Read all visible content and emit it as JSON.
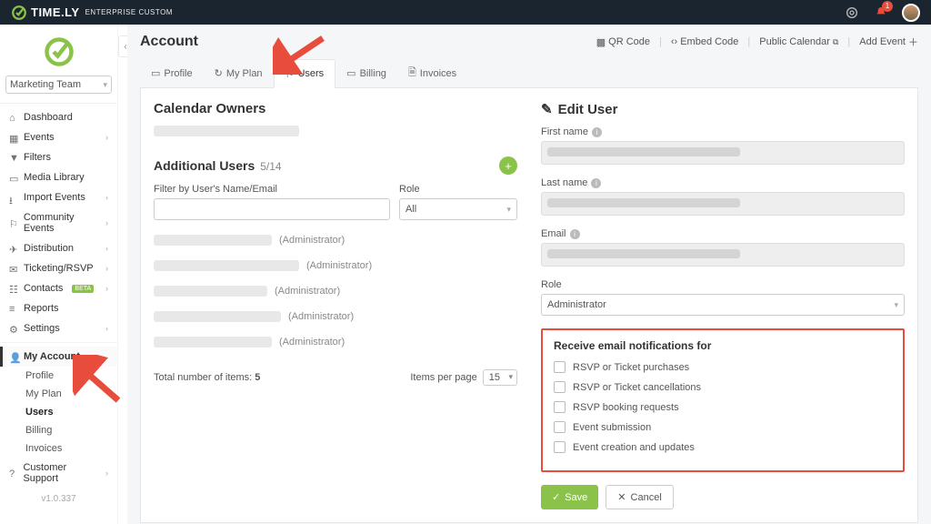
{
  "brand": {
    "name": "TIME.LY",
    "suffix": "ENTERPRISE CUSTOM"
  },
  "topbar": {
    "notif_count": "1"
  },
  "team_selector": {
    "value": "Marketing Team"
  },
  "sidebar": {
    "items": [
      {
        "label": "Dashboard",
        "icon": "dashboard"
      },
      {
        "label": "Events",
        "icon": "calendar",
        "expandable": true
      },
      {
        "label": "Filters",
        "icon": "filter"
      },
      {
        "label": "Media Library",
        "icon": "media"
      },
      {
        "label": "Import Events",
        "icon": "import",
        "expandable": true
      },
      {
        "label": "Community Events",
        "icon": "community",
        "expandable": true
      },
      {
        "label": "Distribution",
        "icon": "distribution",
        "expandable": true
      },
      {
        "label": "Ticketing/RSVP",
        "icon": "ticket",
        "expandable": true
      },
      {
        "label": "Contacts",
        "icon": "contacts",
        "expandable": true,
        "badge": "BETA"
      },
      {
        "label": "Reports",
        "icon": "reports"
      },
      {
        "label": "Settings",
        "icon": "settings",
        "expandable": true
      }
    ],
    "account": {
      "label": "My Account"
    },
    "account_sub": [
      {
        "label": "Profile"
      },
      {
        "label": "My Plan"
      },
      {
        "label": "Users",
        "active": true
      },
      {
        "label": "Billing"
      },
      {
        "label": "Invoices"
      }
    ],
    "support": {
      "label": "Customer Support"
    },
    "version": "v1.0.337"
  },
  "header": {
    "title": "Account",
    "actions": {
      "qr": "QR Code",
      "embed": "Embed Code",
      "public": "Public Calendar",
      "add": "Add Event"
    }
  },
  "tabs": [
    {
      "label": "Profile"
    },
    {
      "label": "My Plan"
    },
    {
      "label": "Users",
      "active": true
    },
    {
      "label": "Billing"
    },
    {
      "label": "Invoices"
    }
  ],
  "left": {
    "owners_title": "Calendar Owners",
    "addl_title": "Additional Users",
    "addl_count": "5/14",
    "filter_name_label": "Filter by User's Name/Email",
    "role_label": "Role",
    "role_value": "All",
    "role_text": "(Administrator)",
    "total_label": "Total number of items:",
    "total_value": "5",
    "ipp_label": "Items per page",
    "ipp_value": "15"
  },
  "right": {
    "title": "Edit User",
    "first_name": "First name",
    "last_name": "Last name",
    "email": "Email",
    "role_label": "Role",
    "role_value": "Administrator",
    "notif_title": "Receive email notifications for",
    "notifs": [
      "RSVP or Ticket purchases",
      "RSVP or Ticket cancellations",
      "RSVP booking requests",
      "Event submission",
      "Event creation and updates"
    ],
    "save": "Save",
    "cancel": "Cancel"
  }
}
